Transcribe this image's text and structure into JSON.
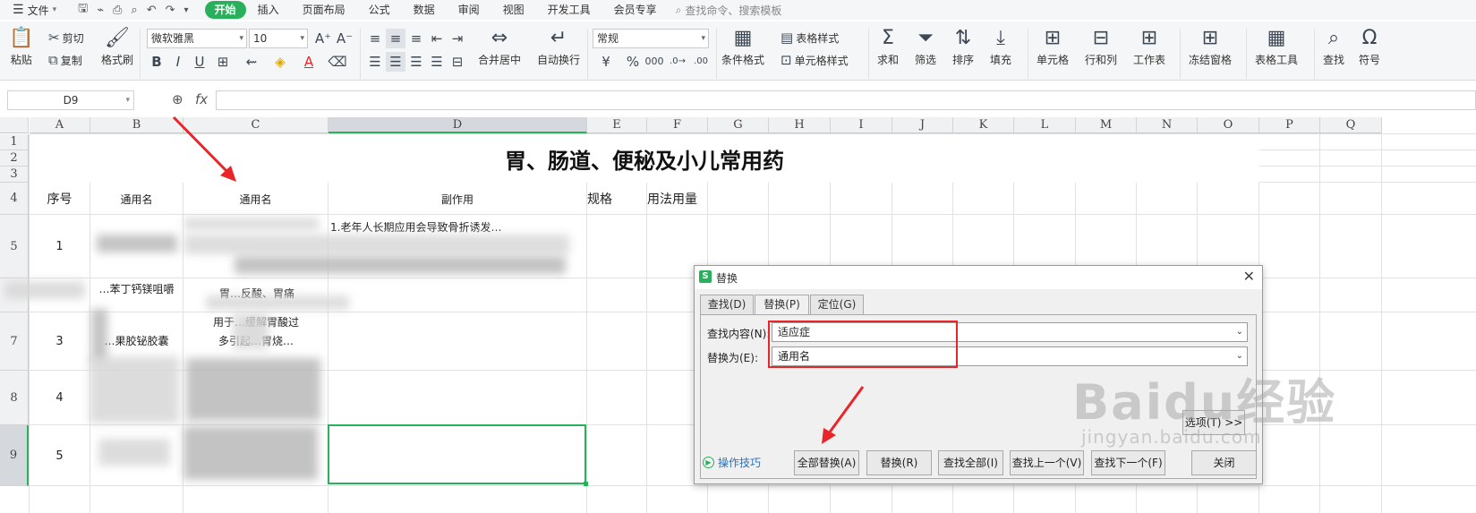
{
  "menu": {
    "file_label": "文件",
    "tabs": [
      "开始",
      "插入",
      "页面布局",
      "公式",
      "数据",
      "审阅",
      "视图",
      "开发工具",
      "会员专享"
    ],
    "search_placeholder": "查找命令、搜索模板"
  },
  "ribbon": {
    "paste": "粘贴",
    "cut": "剪切",
    "copy": "复制",
    "format_painter": "格式刷",
    "font_name": "微软雅黑",
    "font_size": "10",
    "merge_center": "合并居中",
    "wrap_text": "自动换行",
    "number_format": "常规",
    "conditional_format": "条件格式",
    "table_style": "表格样式",
    "cell_style": "单元格样式",
    "sum": "求和",
    "filter": "筛选",
    "sort": "排序",
    "fill": "填充",
    "cell": "单元格",
    "row_col": "行和列",
    "worksheet": "工作表",
    "freeze": "冻结窗格",
    "table_tools": "表格工具",
    "find": "查找",
    "symbol": "符号"
  },
  "formula_bar": {
    "name_box": "D9",
    "fx": "fx",
    "content": ""
  },
  "sheet": {
    "columns": [
      "A",
      "B",
      "C",
      "D",
      "E",
      "F",
      "G",
      "H",
      "I",
      "J",
      "K",
      "L",
      "M",
      "N",
      "O",
      "P",
      "Q"
    ],
    "rows": [
      "1",
      "2",
      "3",
      "4",
      "5",
      "",
      "7",
      "8",
      "9"
    ],
    "title": "胃、肠道、便秘及小儿常用药",
    "header": {
      "seq": "序号",
      "common_name_b": "通用名",
      "common_name_c": "通用名",
      "side_effect": "副作用",
      "spec": "规格",
      "usage": "用法用量"
    },
    "row5": {
      "seq": "1",
      "side_effect_partial": "1.老年人长期应用会导致骨折诱发…"
    },
    "row6": {
      "b_partial": "…苯丁钙镁咀嚼",
      "c_partial": "胃…反酸、胃痛"
    },
    "row7": {
      "seq": "3",
      "b_partial": "…果胶铋胶囊",
      "c_line1": "用于…缓解胃酸过",
      "c_line2": "多引起…胃烧…"
    },
    "row8": {
      "seq": "4"
    },
    "row9": {
      "seq": "5"
    }
  },
  "dialog": {
    "title": "替换",
    "tabs": [
      "查找(D)",
      "替换(P)",
      "定位(G)"
    ],
    "find_label": "查找内容(N):",
    "find_value": "适应症",
    "replace_label": "替换为(E):",
    "replace_value": "通用名",
    "options_button": "选项(T) >>",
    "tips_link": "操作技巧",
    "buttons": {
      "replace_all": "全部替换(A)",
      "replace": "替换(R)",
      "find_all": "查找全部(I)",
      "find_prev": "查找上一个(V)",
      "find_next": "查找下一个(F)",
      "close": "关闭"
    }
  },
  "watermark": {
    "main": "Baidu经验",
    "sub": "jingyan.baidu.com"
  },
  "colors": {
    "accent": "#2ab05c",
    "annotation": "#e8262a",
    "link": "#2f6fb5"
  }
}
